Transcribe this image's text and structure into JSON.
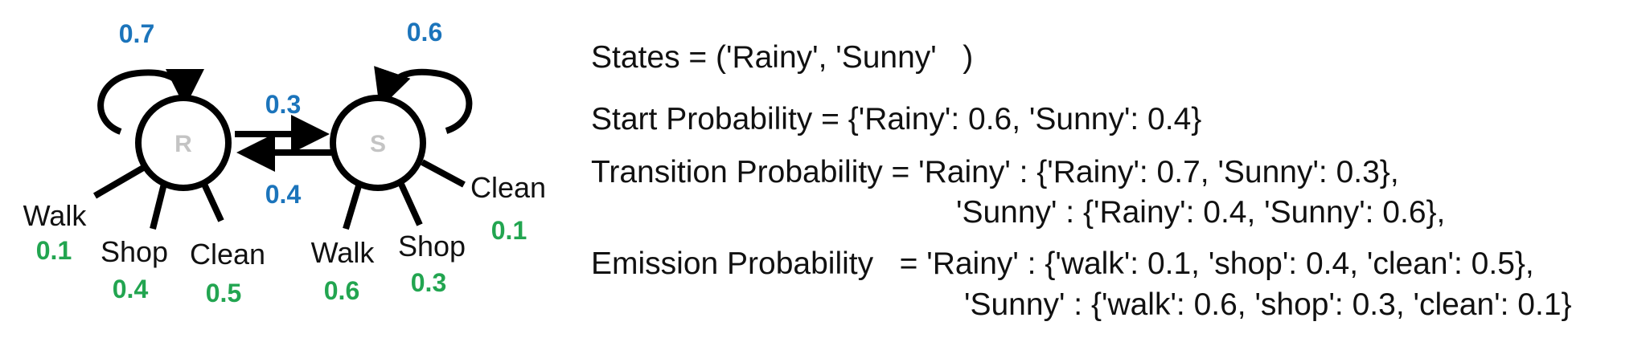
{
  "states": [
    {
      "id": "R",
      "label": "R",
      "self_prob": "0.7",
      "observations": [
        {
          "label": "Walk",
          "prob": "0.1"
        },
        {
          "label": "Shop",
          "prob": "0.4"
        },
        {
          "label": "Clean",
          "prob": "0.5"
        }
      ]
    },
    {
      "id": "S",
      "label": "S",
      "self_prob": "0.6",
      "observations": [
        {
          "label": "Walk",
          "prob": "0.6"
        },
        {
          "label": "Shop",
          "prob": "0.3"
        },
        {
          "label": "Clean",
          "prob": "0.1"
        }
      ]
    }
  ],
  "transitions": {
    "r_to_s": "0.3",
    "s_to_r": "0.4"
  },
  "colors": {
    "transition": "#1b74bb",
    "emission": "#22a550",
    "state_label": "#c4c4c4",
    "stroke": "#000000"
  },
  "text_lines": {
    "states": "States = ('Rainy', 'Sunny'   )",
    "start": "Start Probability = {'Rainy': 0.6, 'Sunny': 0.4}",
    "transition_1": "Transition Probability = 'Rainy' : {'Rainy': 0.7, 'Sunny': 0.3},",
    "transition_2": "'Sunny' : {'Rainy': 0.4, 'Sunny': 0.6},",
    "emission_1": "Emission Probability   = 'Rainy' : {'walk': 0.1, 'shop': 0.4, 'clean': 0.5},",
    "emission_2": "'Sunny' : {'walk': 0.6, 'shop': 0.3, 'clean': 0.1}"
  }
}
